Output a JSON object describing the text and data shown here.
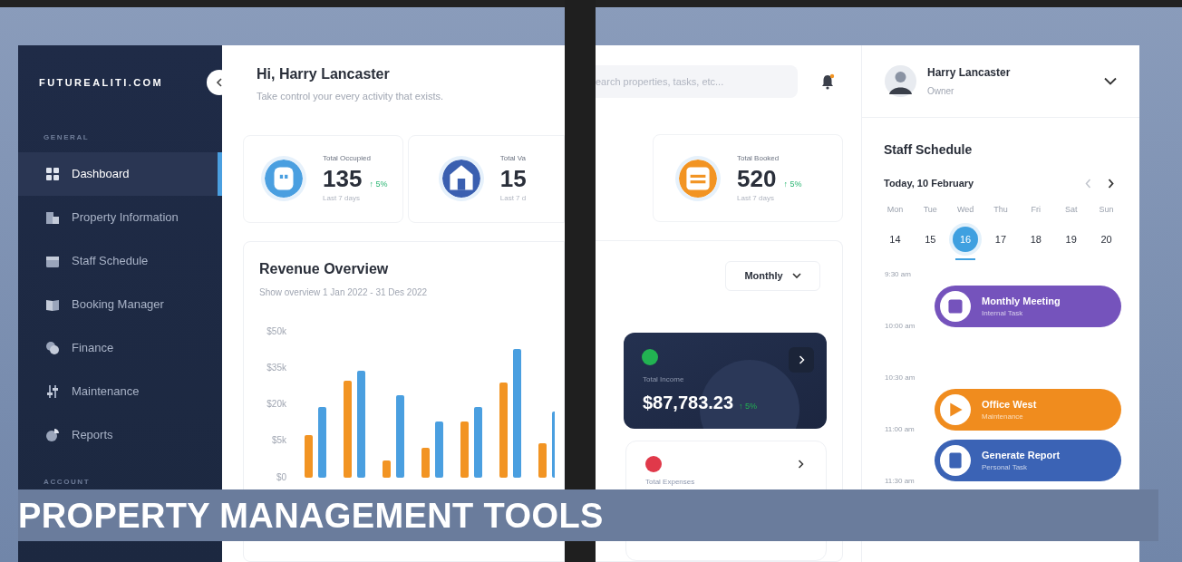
{
  "brand": "FUTUREALITI.COM",
  "sidebar": {
    "general_heading": "GENERAL",
    "items": [
      {
        "label": "Dashboard",
        "selected": true
      },
      {
        "label": "Property Information",
        "selected": false
      },
      {
        "label": "Staff Schedule",
        "selected": false
      },
      {
        "label": "Booking Manager",
        "selected": false
      },
      {
        "label": "Finance",
        "selected": false
      },
      {
        "label": "Maintenance",
        "selected": false
      },
      {
        "label": "Reports",
        "selected": false
      }
    ],
    "account_heading": "ACCOUNT"
  },
  "greeting": {
    "title": "Hi, Harry Lancaster",
    "subtitle": "Take control your every activity that exists."
  },
  "search": {
    "placeholder": "earch properties, tasks, etc..."
  },
  "stats": [
    {
      "label": "Total Occupied",
      "value": "135",
      "change": "↑ 5%",
      "period": "Last 7 days",
      "color": "#4a9fe0"
    },
    {
      "label": "Total Va",
      "value": "15",
      "period": "Last 7 d",
      "color": "#3a5fb0"
    },
    {
      "label": "Total Booked",
      "value": "520",
      "change": "↑ 5%",
      "period": "Last 7 days",
      "color": "#f29423"
    }
  ],
  "revenue": {
    "title": "Revenue Overview",
    "subtitle": "Show overview 1 Jan 2022 - 31 Des 2022",
    "period": "Monthly",
    "axis_labels": [
      "$50k",
      "$35k",
      "$20k",
      "$5k",
      "$0"
    ]
  },
  "income": {
    "label": "Total Income",
    "value": "$87,783.23",
    "change": "↑ 5%"
  },
  "expenses": {
    "label": "Total Expenses"
  },
  "profile": {
    "name": "Harry Lancaster",
    "role": "Owner"
  },
  "schedule": {
    "title": "Staff Schedule",
    "date": "Today, 10 February",
    "days": [
      {
        "name": "Mon",
        "date": "14",
        "selected": false
      },
      {
        "name": "Tue",
        "date": "15",
        "selected": false
      },
      {
        "name": "Wed",
        "date": "16",
        "selected": true
      },
      {
        "name": "Thu",
        "date": "17",
        "selected": false
      },
      {
        "name": "Fri",
        "date": "18",
        "selected": false
      },
      {
        "name": "Sat",
        "date": "19",
        "selected": false
      },
      {
        "name": "Sun",
        "date": "20",
        "selected": false
      }
    ],
    "times": [
      "9:30 am",
      "10:00 am",
      "10:30 am",
      "11:00 am",
      "11:30 am"
    ],
    "events": [
      {
        "title": "Monthly Meeting",
        "subtitle": "Internal Task",
        "color": "#7553bc"
      },
      {
        "title": "Office West",
        "subtitle": "Maintenance",
        "color": "#f08c1e"
      },
      {
        "title": "Generate Report",
        "subtitle": "Personal Task",
        "color": "#3b63b5"
      }
    ]
  },
  "banner": {
    "title": "PROPERTY MANAGEMENT TOOLS"
  }
}
